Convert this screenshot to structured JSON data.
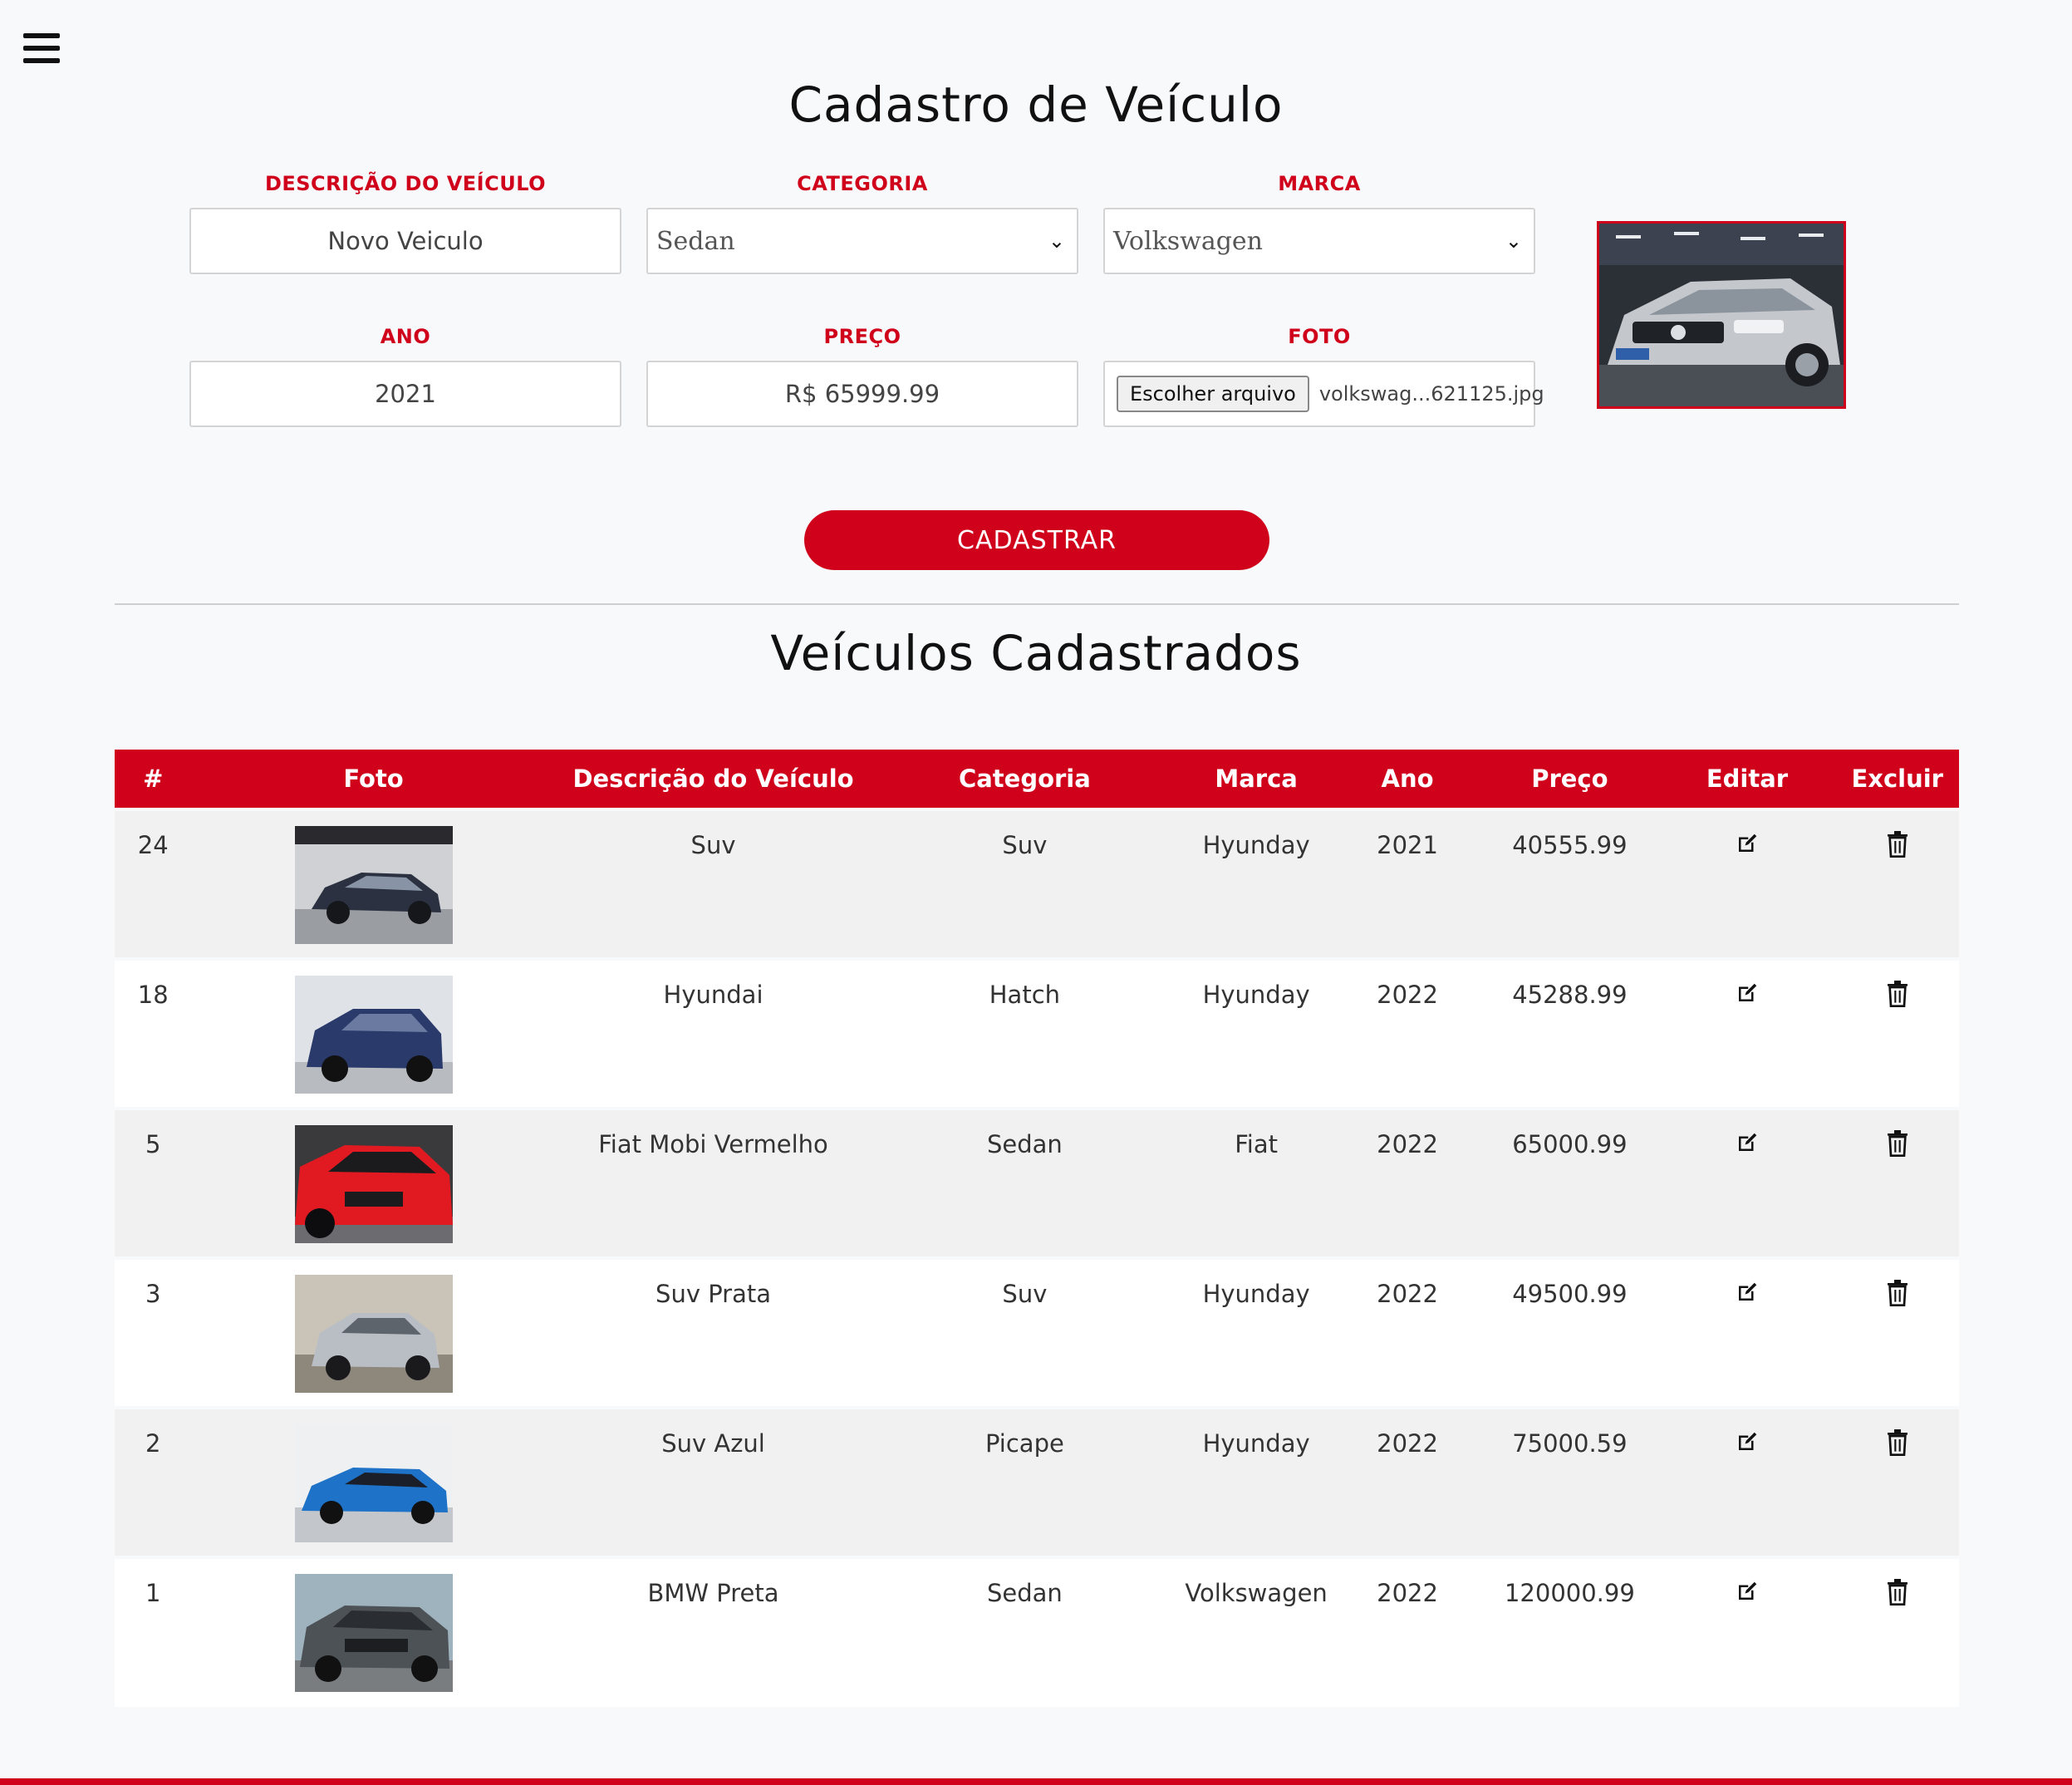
{
  "form": {
    "title": "Cadastro de Veículo",
    "description": {
      "label": "DESCRIÇÃO DO VEÍCULO",
      "value": "Novo Veiculo"
    },
    "category": {
      "label": "CATEGORIA",
      "value": "Sedan"
    },
    "brand": {
      "label": "MARCA",
      "value": "Volkswagen"
    },
    "year": {
      "label": "ANO",
      "value": "2021"
    },
    "price": {
      "label": "PREÇO",
      "value": "R$ 65999.99"
    },
    "photo": {
      "label": "FOTO",
      "button": "Escolher arquivo",
      "filename": "volkswag...621125.jpg"
    },
    "submit": "CADASTRAR"
  },
  "list": {
    "title": "Veículos Cadastrados",
    "headers": [
      "#",
      "Foto",
      "Descrição do Veículo",
      "Categoria",
      "Marca",
      "Ano",
      "Preço",
      "Editar",
      "Excluir"
    ],
    "rows": [
      {
        "id": "24",
        "description": "Suv",
        "category": "Suv",
        "brand": "Hyunday",
        "year": "2021",
        "price": "40555.99"
      },
      {
        "id": "18",
        "description": "Hyundai",
        "category": "Hatch",
        "brand": "Hyunday",
        "year": "2022",
        "price": "45288.99"
      },
      {
        "id": "5",
        "description": "Fiat Mobi Vermelho",
        "category": "Sedan",
        "brand": "Fiat",
        "year": "2022",
        "price": "65000.99"
      },
      {
        "id": "3",
        "description": "Suv Prata",
        "category": "Suv",
        "brand": "Hyunday",
        "year": "2022",
        "price": "49500.99"
      },
      {
        "id": "2",
        "description": "Suv Azul",
        "category": "Picape",
        "brand": "Hyunday",
        "year": "2022",
        "price": "75000.59"
      },
      {
        "id": "1",
        "description": "BMW Preta",
        "category": "Sedan",
        "brand": "Volkswagen",
        "year": "2022",
        "price": "120000.99"
      }
    ]
  },
  "colors": {
    "accent": "#d0021b",
    "background": "#f8f9fb",
    "row_alt": "#f1f1f1"
  },
  "icons": {
    "menu": "hamburger-icon",
    "edit": "edit-icon",
    "delete": "trash-icon",
    "select": "chevron-down-icon"
  }
}
